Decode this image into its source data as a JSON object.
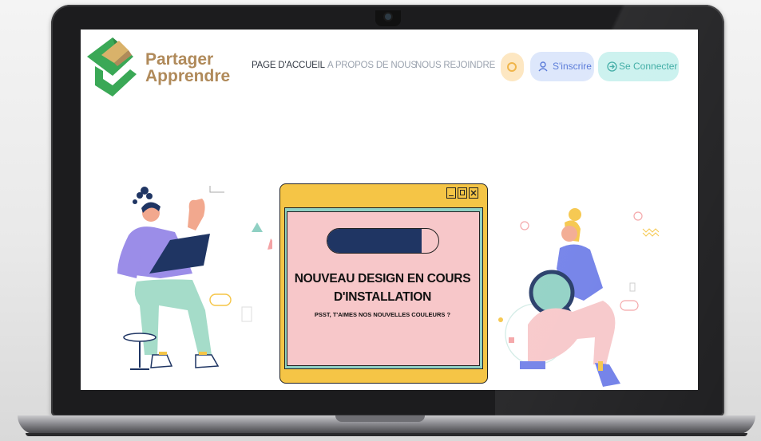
{
  "colors": {
    "accent_green": "#3aa856",
    "brand_text": "#b08a5a",
    "window_yellow": "#f5c546",
    "window_teal": "#8fd0c3",
    "window_pink": "#f7c7c9",
    "progress_navy": "#1f3563"
  },
  "header": {
    "brand_line1": "Partager",
    "brand_line2": "Apprendre",
    "nav": [
      {
        "label": "PAGE D'ACCUEIL",
        "active": true
      },
      {
        "label": "A PROPOS DE NOUS",
        "active": false
      },
      {
        "label": "NOUS REJOINDRE",
        "active": false
      }
    ],
    "search_icon": "search-icon",
    "register_label": "S'inscrire",
    "register_icon": "user-icon",
    "login_label": "Se Connecter",
    "login_icon": "login-arrow-icon"
  },
  "notice": {
    "window_controls": [
      "minimize-icon",
      "maximize-icon",
      "close-icon"
    ],
    "progress": 0.85,
    "title_line1": "NOUVEAU DESIGN EN COURS",
    "title_line2": "D'INSTALLATION",
    "subtitle": "PSST, T'AIMES NOS NOUVELLES COULEURS ?"
  },
  "illustrations": [
    "person-with-laptop-illustration",
    "person-with-magnifier-illustration"
  ]
}
